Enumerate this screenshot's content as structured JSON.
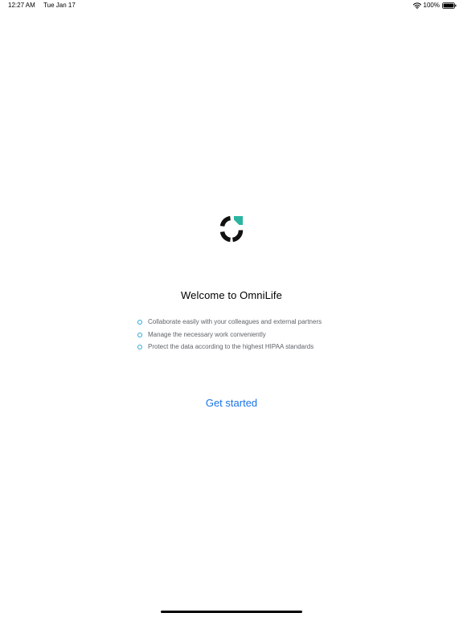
{
  "status_bar": {
    "time": "12:27 AM",
    "date": "Tue Jan 17",
    "battery": "100%",
    "wifi_icon": "wifi-icon",
    "battery_icon": "battery-icon"
  },
  "logo": {
    "icon": "omnilife-logo-icon",
    "colors": {
      "ring": "#111111",
      "accent": "#2bb5a0"
    }
  },
  "welcome": {
    "title": "Welcome to OmniLife"
  },
  "features": [
    {
      "text": "Collaborate easily with your colleagues and external partners"
    },
    {
      "text": "Manage the necessary work conveniently"
    },
    {
      "text": "Protect the data according to the highest HIPAA standards"
    }
  ],
  "actions": {
    "get_started": "Get started"
  },
  "colors": {
    "link": "#1a73e8",
    "bullet": "#30a6d8"
  }
}
